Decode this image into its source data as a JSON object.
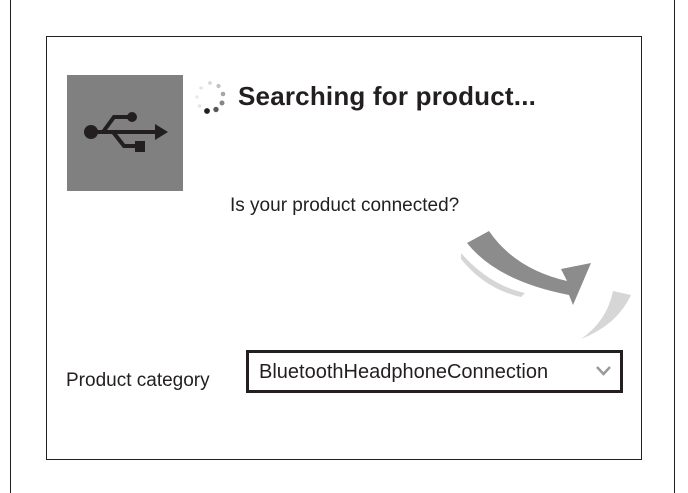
{
  "dialog": {
    "title": "Searching for product...",
    "question": "Is your product connected?",
    "icons": {
      "connection": "usb-icon",
      "progress": "spinner-icon",
      "hint": "curved-arrow-icon",
      "dropdown": "chevron-down-icon"
    }
  },
  "category": {
    "label": "Product category",
    "selected": "BluetoothHeadphoneConnection"
  },
  "colors": {
    "tile": "#808080",
    "text": "#231f20",
    "arrow": "#8c8c8c",
    "chevron": "#9a9a9a"
  }
}
